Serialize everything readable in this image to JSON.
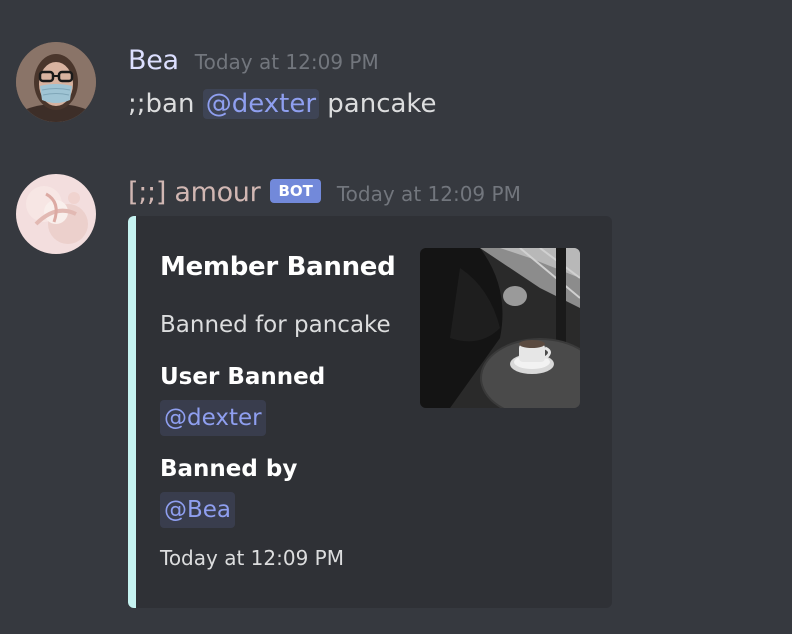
{
  "messages": [
    {
      "username": "Bea",
      "timestamp": "Today at 12:09 PM",
      "avatar_icon": "user-avatar-photo",
      "content_prefix": ";;ban",
      "content_mention": "@dexter",
      "content_suffix": "pancake"
    },
    {
      "username": "[;;] amour",
      "bot_tag": "BOT",
      "timestamp": "Today at 12:09 PM",
      "avatar_icon": "bot-avatar-pink",
      "embed": {
        "title": "Member Banned",
        "description": "Banned for pancake",
        "fields": [
          {
            "name": "User Banned",
            "value": "@dexter"
          },
          {
            "name": "Banned by",
            "value": "@Bea"
          }
        ],
        "footer": "Today at 12:09 PM",
        "accent_color": "#c6f3f1",
        "thumbnail_icon": "coffee-cup-photo"
      }
    }
  ],
  "colors": {
    "background": "#36393f",
    "embed_background": "#2f3136",
    "mention": "#8f9ff0",
    "bot_tag": "#7289da",
    "bot_name": "#d1b7b3"
  }
}
